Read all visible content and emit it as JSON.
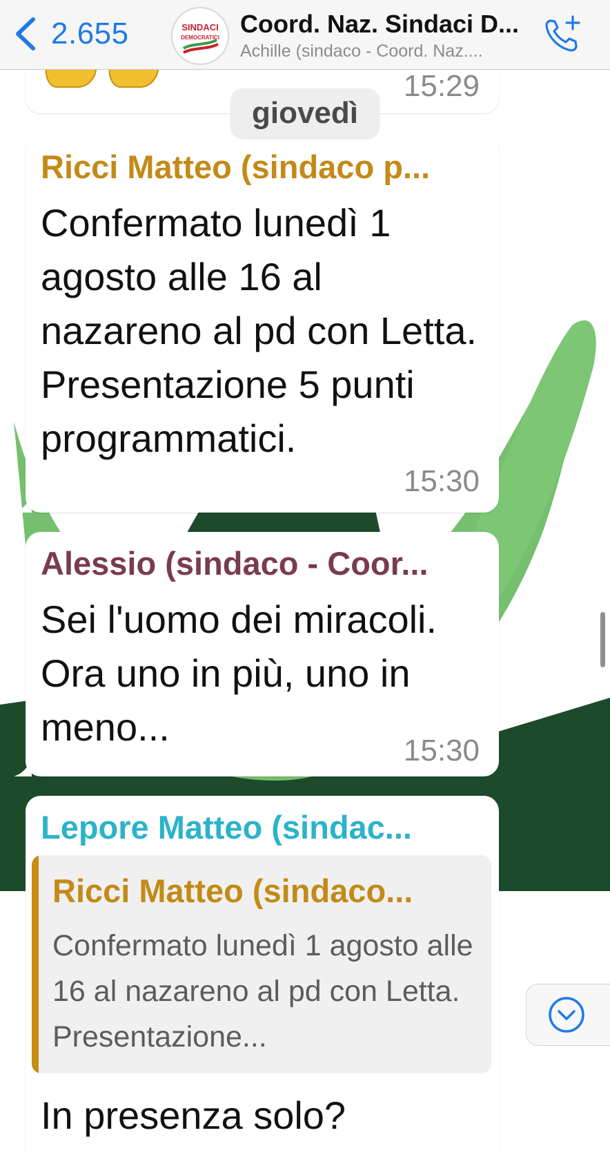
{
  "header": {
    "back_count": "2.655",
    "title": "Coord. Naz. Sindaci D...",
    "subtitle": "Achille (sindaco - Coord. Naz....",
    "avatar_logo_text": "SINDACI DEMOCRATICI",
    "call_icon": "phone-plus-icon"
  },
  "previous_message": {
    "time": "15:29",
    "emoji_icon": "hands-emoji-icon"
  },
  "date_separator": "giovedì",
  "messages": [
    {
      "sender": "Ricci Matteo (sindaco p...",
      "sender_color": "#c38a18",
      "text": "Confermato lunedì 1 agosto alle 16 al nazareno al pd con Letta. Presentazione 5 punti programmatici.",
      "time": "15:30"
    },
    {
      "sender": "Alessio (sindaco - Coor...",
      "sender_color": "#7a3b4e",
      "text": "Sei l'uomo dei miracoli. Ora uno in più, uno in meno...",
      "time": "15:30"
    },
    {
      "sender": "Lepore  Matteo (sindac...",
      "sender_color": "#2bb3c8",
      "quoted": {
        "sender": "Ricci Matteo (sindaco...",
        "text": "Confermato lunedì 1 agosto alle 16 al nazareno al pd con Letta. Presentazione..."
      },
      "text": "In presenza solo?"
    }
  ],
  "scroll_down_icon": "chevron-down-circle-icon",
  "colors": {
    "accent": "#1f7ae6",
    "wallpaper_green_light": "#76bf6e",
    "wallpaper_green_dark": "#1d4a2b"
  }
}
